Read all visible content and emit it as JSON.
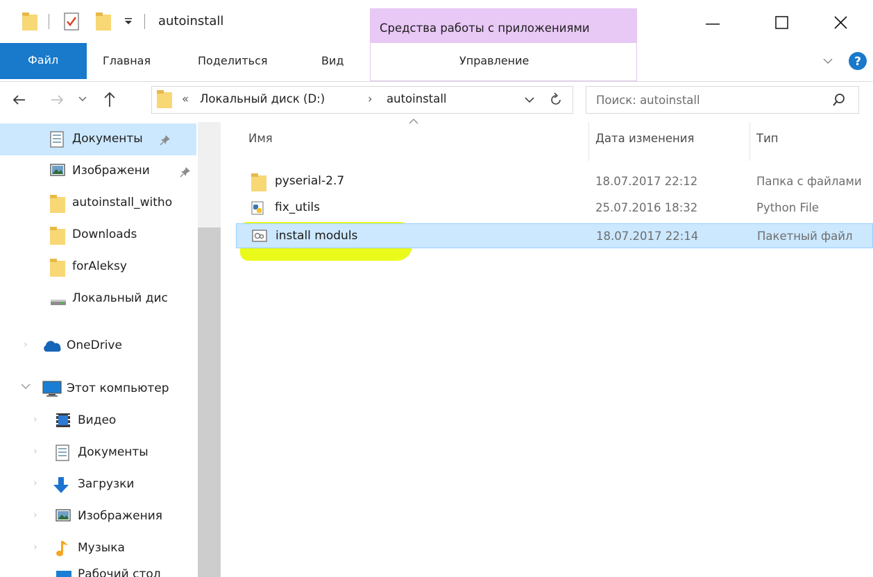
{
  "window": {
    "title": "autoinstall",
    "contextual_group": "Средства работы с приложениями",
    "controls": {
      "minimize": "—",
      "maximize": "☐",
      "close": "✕"
    }
  },
  "ribbon": {
    "tabs": [
      "Файл",
      "Главная",
      "Поделиться",
      "Вид",
      "Управление"
    ],
    "help_glyph": "?"
  },
  "address": {
    "overflow": "«",
    "crumbs": [
      "Локальный диск (D:)",
      "autoinstall"
    ],
    "separator": "›"
  },
  "search": {
    "placeholder": "Поиск: autoinstall"
  },
  "nav": {
    "quick_access": [
      {
        "label": "Документы",
        "icon": "documents-icon",
        "pinned": true,
        "selected": true
      },
      {
        "label": "Изображени",
        "icon": "pictures-icon",
        "pinned": true
      },
      {
        "label": "autoinstall_witho",
        "icon": "folder-icon"
      },
      {
        "label": "Downloads",
        "icon": "folder-icon"
      },
      {
        "label": "forAleksy",
        "icon": "folder-icon"
      },
      {
        "label": "Локальный дис",
        "icon": "drive-icon"
      }
    ],
    "onedrive": {
      "label": "OneDrive",
      "icon": "cloud-icon"
    },
    "this_pc": {
      "label": "Этот компьютер",
      "icon": "computer-icon"
    },
    "pc_children": [
      {
        "label": "Видео",
        "icon": "video-icon"
      },
      {
        "label": "Документы",
        "icon": "documents-icon"
      },
      {
        "label": "Загрузки",
        "icon": "downloads-icon"
      },
      {
        "label": "Изображения",
        "icon": "pictures-icon"
      },
      {
        "label": "Музыка",
        "icon": "music-icon"
      },
      {
        "label": "Рабочий стол",
        "icon": "desktop-icon"
      }
    ]
  },
  "columns": {
    "name": "Имя",
    "date": "Дата изменения",
    "type": "Тип"
  },
  "files": [
    {
      "name": "pyserial-2.7",
      "date": "18.07.2017 22:12",
      "type": "Папка с файлами",
      "icon": "folder-icon"
    },
    {
      "name": "fix_utils",
      "date": "25.07.2016 18:32",
      "type": "Python File",
      "icon": "python-file-icon"
    },
    {
      "name": "install moduls",
      "date": "18.07.2017 22:14",
      "type": "Пакетный файл",
      "icon": "batch-file-icon",
      "selected": true
    }
  ],
  "colors": {
    "accent": "#1979ca",
    "selection": "#cce8ff",
    "contextual": "#e8c8f5",
    "highlight": "#e8fb08"
  }
}
